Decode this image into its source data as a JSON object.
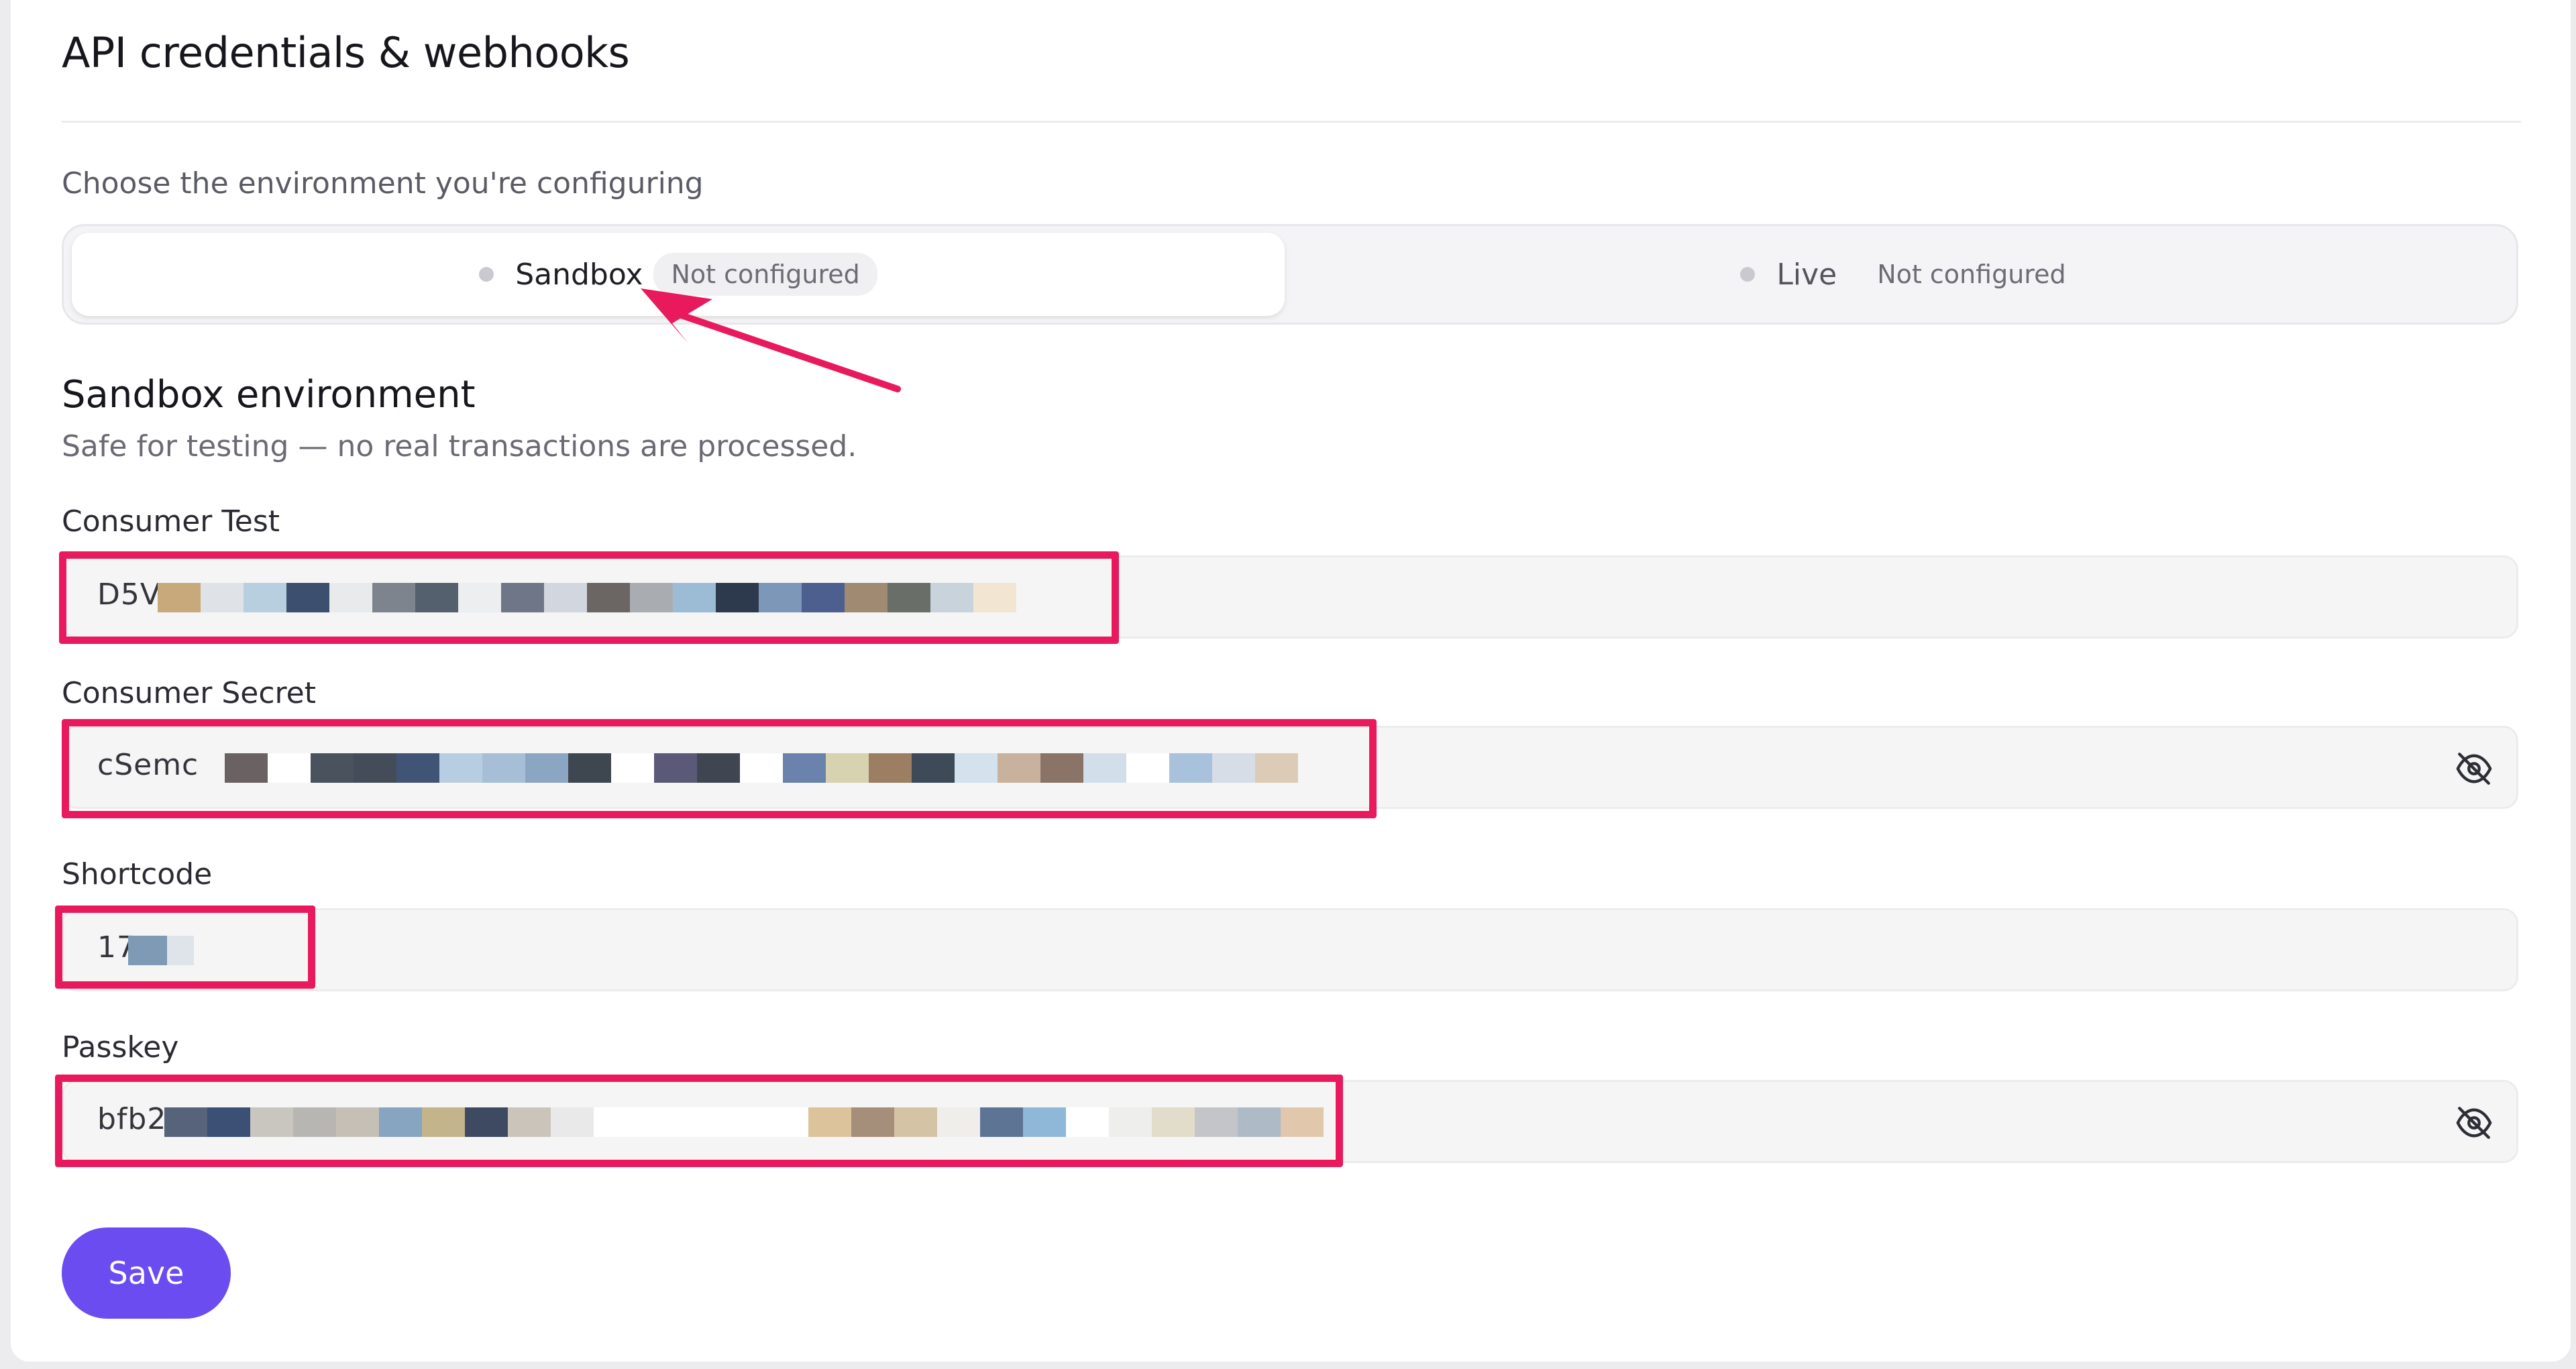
{
  "header": {
    "title": "API credentials & webhooks"
  },
  "environment": {
    "prompt": "Choose the environment you're configuring",
    "options": [
      {
        "label": "Sandbox",
        "status": "Not configured",
        "selected": true
      },
      {
        "label": "Live",
        "status": "Not configured",
        "selected": false
      }
    ]
  },
  "section": {
    "title": "Sandbox environment",
    "subtitle": "Safe for testing — no real transactions are processed."
  },
  "fields": {
    "consumer_test": {
      "label": "Consumer Test",
      "visible_value": "D5V"
    },
    "consumer_secret": {
      "label": "Consumer Secret",
      "visible_value": "cSemc"
    },
    "shortcode": {
      "label": "Shortcode",
      "visible_value": "17"
    },
    "passkey": {
      "label": "Passkey",
      "visible_value": "bfb2"
    }
  },
  "actions": {
    "save_label": "Save"
  },
  "colors": {
    "accent": "#6a4cf0",
    "annotation": "#e8195c",
    "status_dot": "#c9c9cf"
  },
  "icons": {
    "secret_toggle": "eye-off-icon",
    "passkey_toggle": "eye-off-icon"
  }
}
